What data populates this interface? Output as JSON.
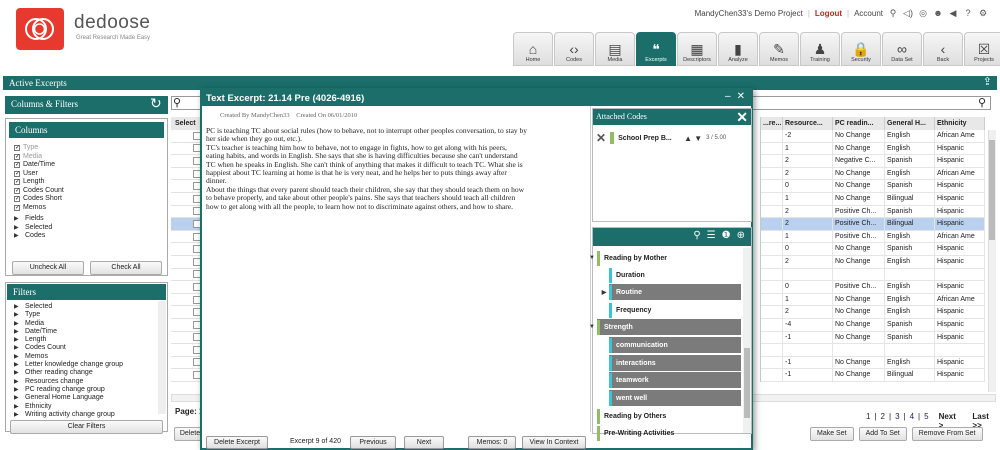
{
  "brand": {
    "name": "dedoose",
    "tagline": "Great Research Made Easy"
  },
  "topbar": {
    "project": "MandyChen33's Demo Project",
    "logout": "Logout",
    "account": "Account"
  },
  "nav": [
    {
      "label": "Home",
      "icon": "home-icon",
      "glyph": "⌂"
    },
    {
      "label": "Codes",
      "icon": "codes-icon",
      "glyph": "‹›"
    },
    {
      "label": "Media",
      "icon": "media-icon",
      "glyph": "▤"
    },
    {
      "label": "Excerpts",
      "icon": "quote-icon",
      "glyph": "❝",
      "active": true
    },
    {
      "label": "Descriptors",
      "icon": "clipboard-icon",
      "glyph": "▦"
    },
    {
      "label": "Analyze",
      "icon": "bar-chart-icon",
      "glyph": "▮"
    },
    {
      "label": "Memos",
      "icon": "memo-icon",
      "glyph": "✎"
    },
    {
      "label": "Training",
      "icon": "person-icon",
      "glyph": "♟"
    },
    {
      "label": "Security",
      "icon": "lock-icon",
      "glyph": "🔒"
    },
    {
      "label": "Data Set",
      "icon": "binoculars-icon",
      "glyph": "∞"
    },
    {
      "label": "Back",
      "icon": "back-icon",
      "glyph": "‹"
    },
    {
      "label": "Projects",
      "icon": "projects-icon",
      "glyph": "☒"
    }
  ],
  "main": {
    "section_title": "Active Excerpts"
  },
  "columns_filters": {
    "title": "Columns & Filters",
    "columns_title": "Columns",
    "columns": [
      {
        "label": "Type",
        "checked": true,
        "dim": true
      },
      {
        "label": "Media",
        "checked": true,
        "dim": true
      },
      {
        "label": "Date/Time",
        "checked": true
      },
      {
        "label": "User",
        "checked": true
      },
      {
        "label": "Length",
        "checked": true
      },
      {
        "label": "Codes Count",
        "checked": true
      },
      {
        "label": "Codes Short",
        "checked": true
      },
      {
        "label": "Memos",
        "checked": true
      }
    ],
    "column_groups": [
      "Fields",
      "Selected",
      "Codes"
    ],
    "uncheck_all": "Uncheck All",
    "check_all": "Check All",
    "filters_title": "Filters",
    "filters": [
      "Selected",
      "Type",
      "Media",
      "Date/Time",
      "Length",
      "Codes Count",
      "Memos",
      "Letter knowledge change group",
      "Other reading change",
      "Resources change",
      "PC reading change group",
      "General Home Language",
      "Ethnicity",
      "Writing activity change group"
    ],
    "clear_filters": "Clear Filters"
  },
  "table": {
    "select_header": "Select",
    "headers": [
      "...re...",
      "Resource...",
      "PC readin...",
      "General H...",
      "Ethnicity"
    ],
    "rows": [
      [
        "",
        "-2",
        "No Change",
        "English",
        "African Ame"
      ],
      [
        "",
        "1",
        "No Change",
        "English",
        "Hispanic"
      ],
      [
        "",
        "2",
        "Negative C...",
        "Spanish",
        "Hispanic"
      ],
      [
        "",
        "2",
        "No Change",
        "English",
        "African Ame"
      ],
      [
        "",
        "0",
        "No Change",
        "Spanish",
        "Hispanic"
      ],
      [
        "",
        "1",
        "No Change",
        "Bilingual",
        "Hispanic"
      ],
      [
        "",
        "2",
        "Positive Ch...",
        "Spanish",
        "Hispanic"
      ],
      [
        "",
        "2",
        "Positive Ch...",
        "Bilingual",
        "Hispanic"
      ],
      [
        "",
        "1",
        "Positive Ch...",
        "English",
        "African Ame"
      ],
      [
        "",
        "0",
        "No Change",
        "Spanish",
        "Hispanic"
      ],
      [
        "",
        "2",
        "No Change",
        "English",
        "Hispanic"
      ],
      [
        "",
        "",
        "",
        "",
        ""
      ],
      [
        "",
        "0",
        "Positive Ch...",
        "English",
        "Hispanic"
      ],
      [
        "",
        "1",
        "No Change",
        "English",
        "African Ame"
      ],
      [
        "",
        "2",
        "No Change",
        "English",
        "Hispanic"
      ],
      [
        "",
        "-4",
        "No Change",
        "Spanish",
        "Hispanic"
      ],
      [
        "",
        "-1",
        "No Change",
        "Spanish",
        "Hispanic"
      ],
      [
        "",
        "",
        "",
        "",
        ""
      ],
      [
        "",
        "-1",
        "No Change",
        "English",
        "Hispanic"
      ],
      [
        "",
        "-1",
        "No Change",
        "Bilingual",
        "Hispanic"
      ]
    ],
    "highlight_row": 7,
    "page_label": "Page: 1",
    "pages": [
      "1",
      "2",
      "3",
      "4",
      "5"
    ],
    "next": "Next >",
    "last": "Last >>",
    "delete": "Delete",
    "make_set": "Make Set",
    "add_to_set": "Add To Set",
    "remove_from_set": "Remove From Set"
  },
  "modal": {
    "title": "Text Excerpt:  21.14 Pre (4026-4916)",
    "created_by_label": "Created By",
    "created_by": "MandyChen33",
    "created_on_label": "Created On",
    "created_on": "06/01/2010",
    "text_lines": [
      "PC is teaching TC about social rules (how to behave, not to interrupt other peoples conversation, to stay by",
      "her side when they go out, etc.).",
      "TC's teacher is teaching him how to behave, not to engage in fights, how to get along with his peers,",
      "eating habits, and words in English. She says that she is having difficulties because she can't understand",
      "TC when he speaks in English.  She can't think of anything that makes it difficult to teach TC.  What she is",
      "happiest about TC learning at home is that he is very neat, and he helps her to puts things away after",
      "dinner.",
      "About the things that every parent should teach their children, she say that they should teach them on how",
      "to behave properly, and take about other people's pains.  She says that teachers should teach all children",
      "how to get along with all the people, to learn how not to discriminate against others, and how to share."
    ],
    "delete_excerpt": "Delete Excerpt",
    "excerpt_count": "Excerpt 9 of 420",
    "previous": "Previous",
    "next": "Next",
    "memos": "Memos: 0",
    "view_in_context": "View In Context"
  },
  "attached_codes": {
    "title": "Attached Codes",
    "code_name": "School Prep B...",
    "weight": "3 / 5.00"
  },
  "code_tree": [
    {
      "label": "Reading by Mother",
      "level": 0,
      "expand": "▼",
      "color": "#8fbf60",
      "selected": false
    },
    {
      "label": "Duration",
      "level": 1,
      "expand": "",
      "color": "#3cc3d6",
      "selected": false
    },
    {
      "label": "Routine",
      "level": 1,
      "expand": "▶",
      "color": "#3cc3d6",
      "selected": true
    },
    {
      "label": "Frequency",
      "level": 1,
      "expand": "",
      "color": "#3cc3d6",
      "selected": false
    },
    {
      "label": "Strength",
      "level": 0,
      "expand": "▼",
      "color": "#8fbf60",
      "selected": true
    },
    {
      "label": "communication",
      "level": 1,
      "expand": "",
      "color": "#3cc3d6",
      "selected": true
    },
    {
      "label": "interactions",
      "level": 1,
      "expand": "",
      "color": "#3cc3d6",
      "selected": true
    },
    {
      "label": "teamwork",
      "level": 1,
      "expand": "",
      "color": "#3cc3d6",
      "selected": true
    },
    {
      "label": "went well",
      "level": 1,
      "expand": "",
      "color": "#3cc3d6",
      "selected": true
    },
    {
      "label": "Reading by Others",
      "level": 0,
      "expand": "",
      "color": "#8fbf60",
      "selected": false
    },
    {
      "label": "Pre-Writing Activities",
      "level": 0,
      "expand": "",
      "color": "#8fbf60",
      "selected": false
    }
  ]
}
